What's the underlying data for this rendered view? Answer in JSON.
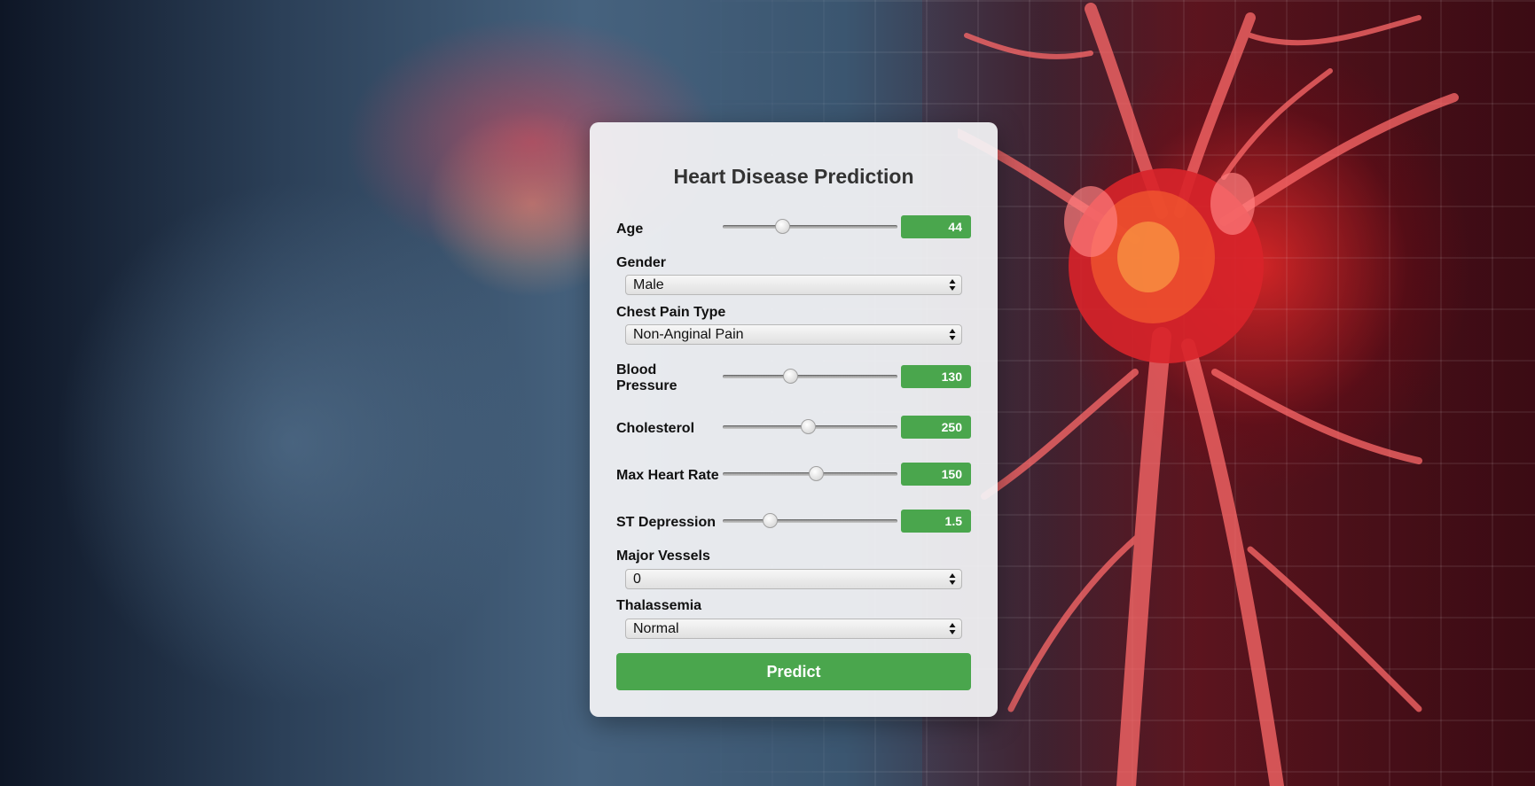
{
  "form": {
    "title": "Heart Disease Prediction",
    "fields": {
      "age": {
        "label": "Age",
        "value": "44",
        "fraction": 0.33
      },
      "gender": {
        "label": "Gender",
        "selected": "Male"
      },
      "chest_pain": {
        "label": "Chest Pain Type",
        "selected": "Non-Anginal Pain"
      },
      "blood_pressure": {
        "label": "Blood Pressure",
        "value": "130",
        "fraction": 0.38
      },
      "cholesterol": {
        "label": "Cholesterol",
        "value": "250",
        "fraction": 0.49
      },
      "max_heart_rate": {
        "label": "Max Heart Rate",
        "value": "150",
        "fraction": 0.54
      },
      "st_depression": {
        "label": "ST Depression",
        "value": "1.5",
        "fraction": 0.25
      },
      "major_vessels": {
        "label": "Major Vessels",
        "selected": "0"
      },
      "thalassemia": {
        "label": "Thalassemia",
        "selected": "Normal"
      }
    },
    "predict_label": "Predict"
  },
  "colors": {
    "accent_green": "#4aa64d",
    "card_bg": "#f4f4f6"
  },
  "icons": {
    "select_arrow": "up-down-arrows-icon"
  }
}
